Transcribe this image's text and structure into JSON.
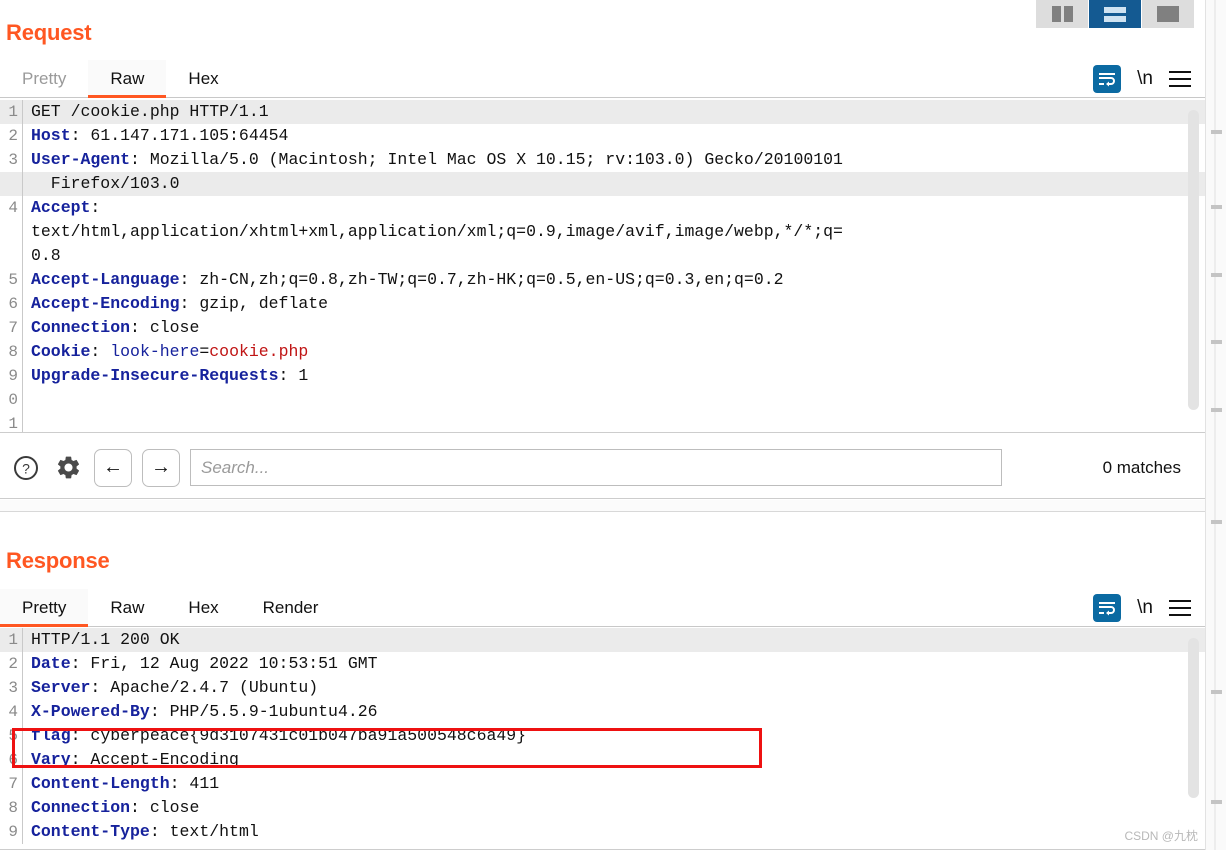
{
  "layout_buttons": [
    {
      "name": "vertical-split",
      "label": "Vertical split",
      "active": false
    },
    {
      "name": "horizontal-split",
      "label": "Horizontal split",
      "active": true
    },
    {
      "name": "single-pane",
      "label": "Single pane",
      "active": false
    }
  ],
  "request": {
    "title": "Request",
    "tabs": [
      {
        "label": "Pretty",
        "active": false,
        "muted": true
      },
      {
        "label": "Raw",
        "active": true,
        "muted": false
      },
      {
        "label": "Hex",
        "active": false,
        "muted": false
      }
    ],
    "actions": {
      "wrap_label": "word-wrap",
      "newline_label": "\\n",
      "menu_label": "menu"
    },
    "lines": [
      {
        "num": "1",
        "highlight": true,
        "segments": [
          {
            "t": "GET /cookie.php HTTP/1.1",
            "c": "plain"
          }
        ]
      },
      {
        "num": "2",
        "highlight": false,
        "segments": [
          {
            "t": "Host",
            "c": "k"
          },
          {
            "t": ": 61.147.171.105:64454",
            "c": "plain"
          }
        ]
      },
      {
        "num": "3",
        "highlight": false,
        "segments": [
          {
            "t": "User-Agent",
            "c": "k"
          },
          {
            "t": ": Mozilla/5.0 (Macintosh; Intel Mac OS X 10.15; rv:103.0) Gecko/20100101",
            "c": "plain"
          }
        ]
      },
      {
        "num": "",
        "highlight": true,
        "segments": [
          {
            "t": "  Firefox/103.0",
            "c": "plain"
          }
        ]
      },
      {
        "num": "4",
        "highlight": false,
        "segments": [
          {
            "t": "Accept",
            "c": "k"
          },
          {
            "t": ":",
            "c": "plain"
          }
        ]
      },
      {
        "num": "",
        "highlight": false,
        "segments": [
          {
            "t": "text/html,application/xhtml+xml,application/xml;q=0.9,image/avif,image/webp,*/*;q=",
            "c": "plain"
          }
        ]
      },
      {
        "num": "",
        "highlight": false,
        "segments": [
          {
            "t": "0.8",
            "c": "plain"
          }
        ]
      },
      {
        "num": "5",
        "highlight": false,
        "segments": [
          {
            "t": "Accept-Language",
            "c": "k"
          },
          {
            "t": ": zh-CN,zh;q=0.8,zh-TW;q=0.7,zh-HK;q=0.5,en-US;q=0.3,en;q=0.2",
            "c": "plain"
          }
        ]
      },
      {
        "num": "6",
        "highlight": false,
        "segments": [
          {
            "t": "Accept-Encoding",
            "c": "k"
          },
          {
            "t": ": gzip, deflate",
            "c": "plain"
          }
        ]
      },
      {
        "num": "7",
        "highlight": false,
        "segments": [
          {
            "t": "Connection",
            "c": "k"
          },
          {
            "t": ": close",
            "c": "plain"
          }
        ]
      },
      {
        "num": "8",
        "highlight": false,
        "segments": [
          {
            "t": "Cookie",
            "c": "k"
          },
          {
            "t": ": ",
            "c": "plain"
          },
          {
            "t": "look-here",
            "c": "kv"
          },
          {
            "t": "=",
            "c": "plain"
          },
          {
            "t": "cookie.php",
            "c": "red"
          }
        ]
      },
      {
        "num": "9",
        "highlight": false,
        "segments": [
          {
            "t": "Upgrade-Insecure-Requests",
            "c": "k"
          },
          {
            "t": ": 1",
            "c": "plain"
          }
        ]
      },
      {
        "num": "0",
        "highlight": false,
        "segments": [
          {
            "t": "",
            "c": "plain"
          }
        ]
      },
      {
        "num": "1",
        "highlight": false,
        "segments": [
          {
            "t": "",
            "c": "plain"
          }
        ]
      }
    ]
  },
  "search": {
    "help_label": "?",
    "settings_label": "settings",
    "prev_label": "←",
    "next_label": "→",
    "value": "",
    "placeholder": "Search...",
    "matches": "0 matches"
  },
  "response": {
    "title": "Response",
    "tabs": [
      {
        "label": "Pretty",
        "active": true,
        "muted": false
      },
      {
        "label": "Raw",
        "active": false,
        "muted": false
      },
      {
        "label": "Hex",
        "active": false,
        "muted": false
      },
      {
        "label": "Render",
        "active": false,
        "muted": false
      }
    ],
    "actions": {
      "wrap_label": "word-wrap",
      "newline_label": "\\n",
      "menu_label": "menu"
    },
    "lines": [
      {
        "num": "1",
        "highlight": true,
        "segments": [
          {
            "t": "HTTP/1.1 200 OK",
            "c": "plain"
          }
        ]
      },
      {
        "num": "2",
        "highlight": false,
        "segments": [
          {
            "t": "Date",
            "c": "k"
          },
          {
            "t": ": Fri, 12 Aug 2022 10:53:51 GMT",
            "c": "plain"
          }
        ]
      },
      {
        "num": "3",
        "highlight": false,
        "segments": [
          {
            "t": "Server",
            "c": "k"
          },
          {
            "t": ": Apache/2.4.7 (Ubuntu)",
            "c": "plain"
          }
        ]
      },
      {
        "num": "4",
        "highlight": false,
        "segments": [
          {
            "t": "X-Powered-By",
            "c": "k"
          },
          {
            "t": ": PHP/5.5.9-1ubuntu4.26",
            "c": "plain"
          }
        ]
      },
      {
        "num": "5",
        "highlight": false,
        "segments": [
          {
            "t": "flag",
            "c": "k"
          },
          {
            "t": ": cyberpeace{9d3107431c01b047ba91a500548c6a49}",
            "c": "plain"
          }
        ]
      },
      {
        "num": "6",
        "highlight": false,
        "segments": [
          {
            "t": "Vary",
            "c": "k"
          },
          {
            "t": ": Accept-Encoding",
            "c": "plain"
          }
        ]
      },
      {
        "num": "7",
        "highlight": false,
        "segments": [
          {
            "t": "Content-Length",
            "c": "k"
          },
          {
            "t": ": 411",
            "c": "plain"
          }
        ]
      },
      {
        "num": "8",
        "highlight": false,
        "segments": [
          {
            "t": "Connection",
            "c": "k"
          },
          {
            "t": ": close",
            "c": "plain"
          }
        ]
      },
      {
        "num": "9",
        "highlight": false,
        "segments": [
          {
            "t": "Content-Type",
            "c": "k"
          },
          {
            "t": ": text/html",
            "c": "plain"
          }
        ]
      }
    ],
    "annotation": {
      "type": "red-rectangle",
      "color": "#ee1111",
      "covers": "flag header line"
    }
  },
  "watermark": "CSDN @九枕",
  "colors": {
    "accent": "#ff5722",
    "header_key": "#16229c",
    "value_red": "#c01515",
    "annotation_red": "#ee1111",
    "active_layout": "#145a92",
    "wrap_icon": "#0b6aa2"
  }
}
